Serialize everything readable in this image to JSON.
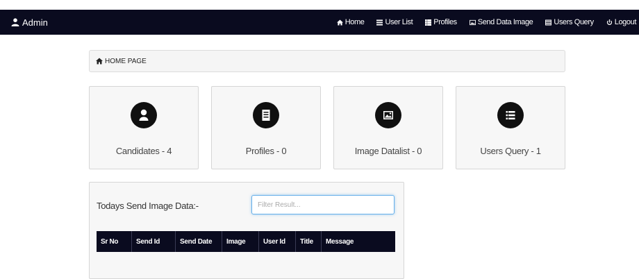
{
  "navbar": {
    "brand": "Admin",
    "items": [
      {
        "label": "Home",
        "icon": "home-icon"
      },
      {
        "label": "User List",
        "icon": "list-icon"
      },
      {
        "label": "Profiles",
        "icon": "grid-icon"
      },
      {
        "label": "Send Data Image",
        "icon": "image-icon"
      },
      {
        "label": "Users Query",
        "icon": "list-icon"
      },
      {
        "label": "Logout",
        "icon": "power-icon"
      }
    ]
  },
  "breadcrumb": {
    "label": "HOME PAGE",
    "icon": "home-icon"
  },
  "cards": [
    {
      "label": "Candidates - 4",
      "icon": "user-icon"
    },
    {
      "label": "Profiles - 0",
      "icon": "document-icon"
    },
    {
      "label": "Image Datalist - 0",
      "icon": "picture-icon"
    },
    {
      "label": "Users Query - 1",
      "icon": "list-icon"
    }
  ],
  "panel": {
    "title": "Todays Send Image Data:-",
    "filter_placeholder": "Filter Result...",
    "filter_value": "",
    "columns": [
      "Sr No",
      "Send Id",
      "Send Date",
      "Image",
      "User Id",
      "Title",
      "Message"
    ]
  },
  "colors": {
    "navbar_bg": "#0a0b1f",
    "icon_circle": "#101010",
    "focus_border": "#66afe9"
  }
}
